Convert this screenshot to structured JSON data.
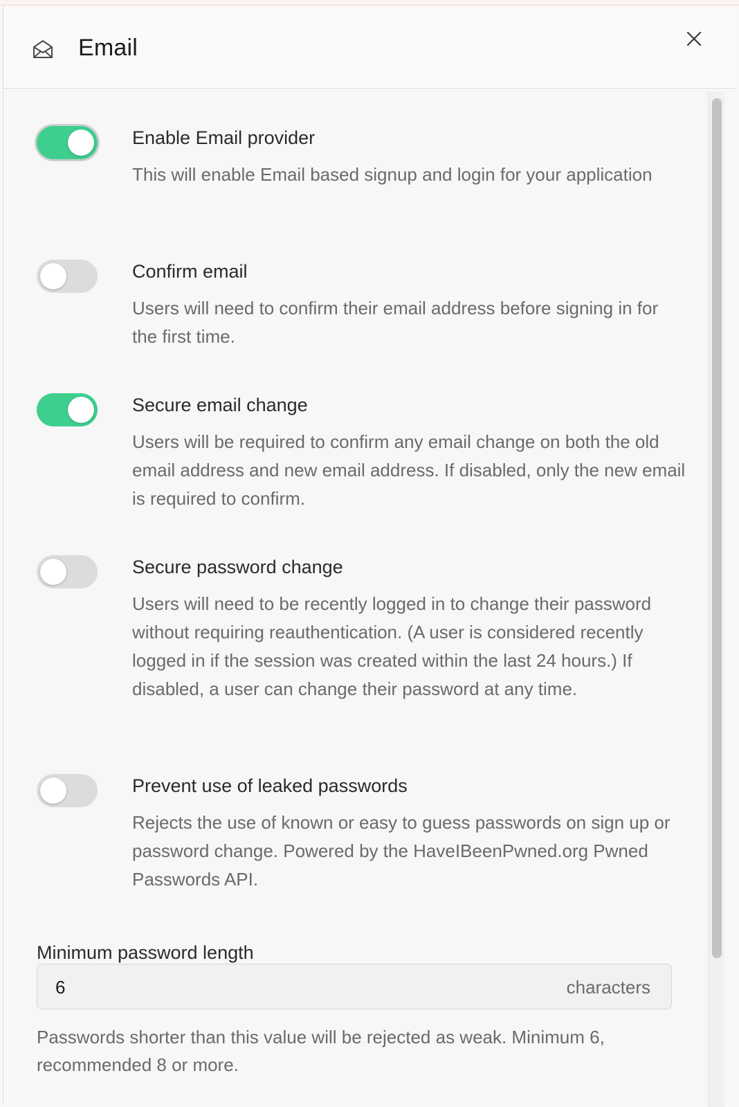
{
  "panel": {
    "title": "Email",
    "icon": "envelope-open-icon",
    "close_icon": "close-icon"
  },
  "settings": [
    {
      "label": "Enable Email provider",
      "description": "This will enable Email based signup and login for your application",
      "enabled": true
    },
    {
      "label": "Confirm email",
      "description": "Users will need to confirm their email address before signing in for the first time.",
      "enabled": false
    },
    {
      "label": "Secure email change",
      "description": "Users will be required to confirm any email change on both the old email address and new email address. If disabled, only the new email is required to confirm.",
      "enabled": true
    },
    {
      "label": "Secure password change",
      "description": "Users will need to be recently logged in to change their password without requiring reauthentication. (A user is considered recently logged in if the session was created within the last 24 hours.) If disabled, a user can change their password at any time.",
      "enabled": false
    },
    {
      "label": "Prevent use of leaked passwords",
      "description": "Rejects the use of known or easy to guess passwords on sign up or password change. Powered by the HaveIBeenPwned.org Pwned Passwords API.",
      "enabled": false
    }
  ],
  "min_password": {
    "label": "Minimum password length",
    "value": "6",
    "suffix": "characters",
    "help": "Passwords shorter than this value will be rejected as weak. Minimum 6, recommended 8 or more."
  },
  "colors": {
    "toggle_on": "#3ecf8e",
    "toggle_off": "#dcdcdc"
  }
}
